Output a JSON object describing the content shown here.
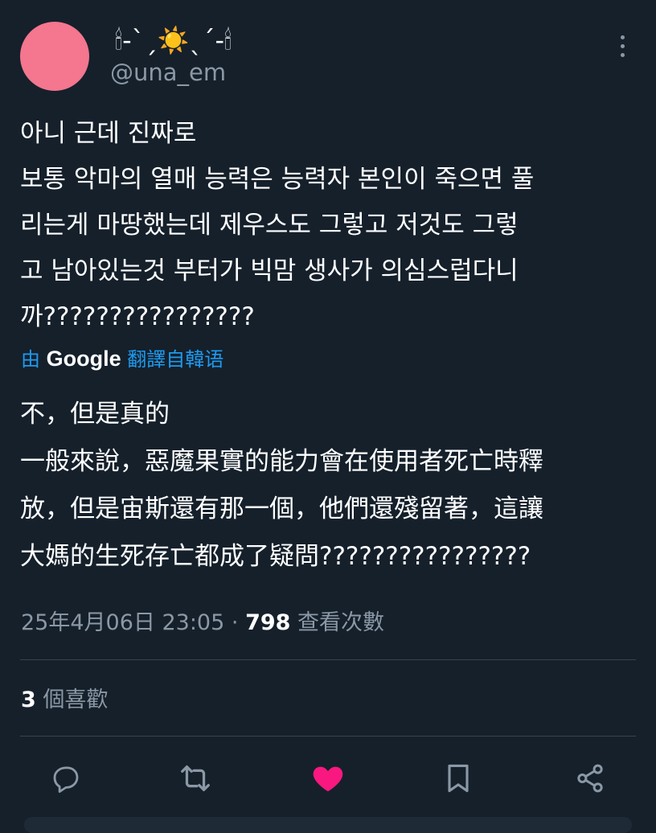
{
  "author": {
    "display_name": "🕯-ˋˏ☀️ˎˊ-🕯",
    "handle": "@una_em",
    "avatar_color": "#f4768f"
  },
  "tweet": {
    "lines": [
      "아니 근데 진짜로",
      "보통 악마의 열매 능력은 능력자 본인이 죽으면 풀",
      "리는게 마땅했는데 제우스도 그렇고 저것도 그렇",
      "고 남아있는것 부터가 빅맘 생사가 의심스럽다니",
      "까????????????????"
    ]
  },
  "translation": {
    "prefix": "由",
    "provider": "Google",
    "suffix": "翻譯自韓语",
    "lines": [
      "不，但是真的",
      "一般來說，惡魔果實的能力會在使用者死亡時釋",
      "放，但是宙斯還有那一個，他們還殘留著，這讓",
      "大媽的生死存亡都成了疑問????????????????"
    ]
  },
  "meta": {
    "timestamp": "25年4月06日 23:05",
    "separator": "·",
    "views_count": "798",
    "views_label": "查看次數"
  },
  "likes": {
    "count": "3",
    "label": "個喜歡"
  },
  "actions": {
    "reply_icon": "reply-icon",
    "retweet_icon": "retweet-icon",
    "like_icon": "heart-filled-icon",
    "bookmark_icon": "bookmark-icon",
    "share_icon": "share-icon",
    "like_color": "#f91880",
    "icon_color": "#8b98a5"
  },
  "colors": {
    "background": "#15202b",
    "link": "#1d9bf0",
    "secondary_text": "#8b98a5"
  }
}
